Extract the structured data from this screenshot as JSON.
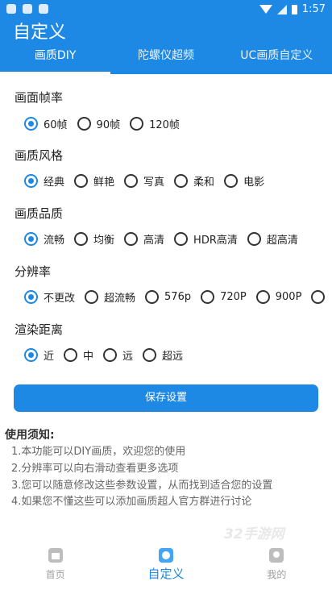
{
  "status_bar": {
    "time": "1:57"
  },
  "app": {
    "title": "自定义"
  },
  "tabs": [
    {
      "label": "画质DIY",
      "active": true
    },
    {
      "label": "陀螺仪超频",
      "active": false
    },
    {
      "label": "UC画质自定义",
      "active": false
    }
  ],
  "sections": [
    {
      "title": "画面帧率",
      "options": [
        "60帧",
        "90帧",
        "120帧"
      ],
      "selected": 0
    },
    {
      "title": "画质风格",
      "options": [
        "经典",
        "鲜艳",
        "写真",
        "柔和",
        "电影"
      ],
      "selected": 0
    },
    {
      "title": "画质品质",
      "options": [
        "流畅",
        "均衡",
        "高清",
        "HDR高清",
        "超高清"
      ],
      "selected": 0
    },
    {
      "title": "分辨率",
      "options": [
        "不更改",
        "超流畅",
        "576p",
        "720P",
        "900P",
        ""
      ],
      "selected": 0
    },
    {
      "title": "渲染距离",
      "options": [
        "近",
        "中",
        "远",
        "超远"
      ],
      "selected": 0
    }
  ],
  "save_button": "保存设置",
  "notice": {
    "title": "使用须知:",
    "lines": [
      "1.本功能可以DIY画质，欢迎您的使用",
      "2.分辨率可以向右滑动查看更多选项",
      "3.您可以随意修改这些参数设置，从而找到适合您的设置",
      "4.如果您不懂这些可以添加画质超人官方群进行讨论"
    ]
  },
  "watermark": "32手游网",
  "bottom_nav": [
    {
      "label": "首页",
      "icon": "home-icon",
      "active": false
    },
    {
      "label": "自定义",
      "icon": "custom-icon",
      "active": true
    },
    {
      "label": "我的",
      "icon": "profile-icon",
      "active": false
    }
  ],
  "colors": {
    "accent": "#1e88e5"
  }
}
